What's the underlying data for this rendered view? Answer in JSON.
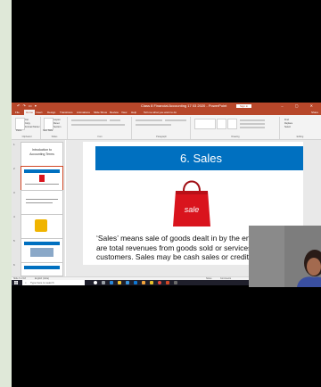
{
  "window": {
    "quick_access": "↶ ↷ ▭ ▾",
    "doc_title": "Class 8 Financial Accounting 17 03 2020 - PowerPoint",
    "sign_in": "Sign in",
    "controls": "– ▢ ✕",
    "share": "Share"
  },
  "ribbon_tabs": [
    "File",
    "Home",
    "Insert",
    "Design",
    "Transitions",
    "Animations",
    "Slide Show",
    "Review",
    "View",
    "Help",
    "Tell me what you want to do"
  ],
  "ribbon": {
    "groups": [
      "Clipboard",
      "Slides",
      "Font",
      "Paragraph",
      "Drawing",
      "Editing"
    ],
    "clipboard_items": [
      "Paste",
      "Cut",
      "Copy",
      "Format Painter"
    ],
    "slides_items": [
      "New Slide",
      "Layout",
      "Reset",
      "Section"
    ],
    "editing_items": [
      "Find",
      "Replace",
      "Select"
    ]
  },
  "slide": {
    "title": "6. Sales",
    "bag_text": "sale",
    "body_lines": [
      "‘Sales’ means sale of goods dealt in by the ent",
      "are total revenues from goods sold or services",
      "customers. Sales may be cash sales or credit sale"
    ]
  },
  "thumbnails": {
    "numbers": [
      "1",
      "2",
      "3",
      "4",
      "5",
      "6",
      "7"
    ],
    "first_title": "Introduction to Accounting Terms"
  },
  "status": {
    "left": "Slide 6 of 18",
    "language": "English (India)",
    "notes": "Notes",
    "comments": "Comments"
  },
  "taskbar": {
    "search_placeholder": "Type here to search"
  },
  "colors": {
    "powerpoint_accent": "#b7472a",
    "slide_title_bg": "#0070c0",
    "bag": "#d9141d"
  }
}
